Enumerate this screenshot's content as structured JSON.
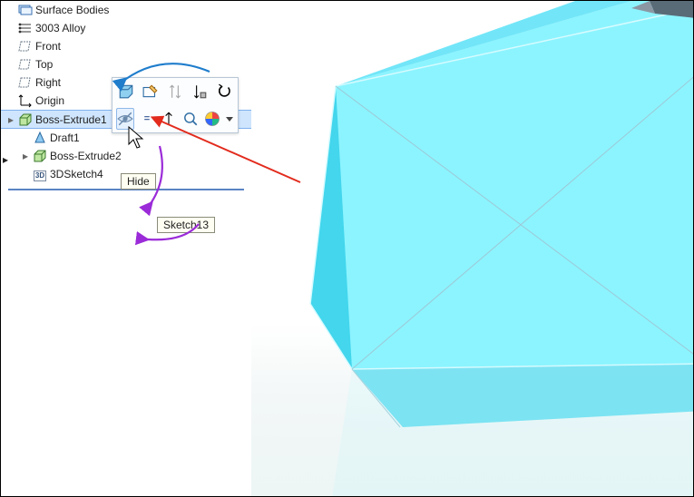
{
  "tree": {
    "items": [
      {
        "id": "surface-bodies",
        "icon": "surfaces",
        "label": "Surface Bodies",
        "selected": false,
        "expandable": false,
        "indent": 0
      },
      {
        "id": "material",
        "icon": "material",
        "label": "3003 Alloy",
        "selected": false,
        "expandable": false,
        "indent": 0
      },
      {
        "id": "front",
        "icon": "plane",
        "label": "Front",
        "selected": false,
        "expandable": false,
        "indent": 0
      },
      {
        "id": "top",
        "icon": "plane",
        "label": "Top",
        "selected": false,
        "expandable": false,
        "indent": 0
      },
      {
        "id": "right",
        "icon": "plane",
        "label": "Right",
        "selected": false,
        "expandable": false,
        "indent": 0
      },
      {
        "id": "origin",
        "icon": "origin",
        "label": "Origin",
        "selected": false,
        "expandable": false,
        "indent": 0
      },
      {
        "id": "boss-extrude1",
        "icon": "extrude",
        "label": "Boss-Extrude1",
        "selected": true,
        "expandable": true,
        "indent": 0
      },
      {
        "id": "draft1",
        "icon": "draft",
        "label": "Draft1",
        "selected": false,
        "expandable": false,
        "indent": 1
      },
      {
        "id": "boss-extrude2",
        "icon": "extrude",
        "label": "Boss-Extrude2",
        "selected": false,
        "expandable": true,
        "indent": 1
      },
      {
        "id": "3dsketch4",
        "icon": "sketch3d",
        "label": "3DSketch4",
        "selected": false,
        "expandable": false,
        "indent": 1
      }
    ]
  },
  "contextToolbar": {
    "row1": [
      "edit-feature",
      "edit-sketch",
      "flip",
      "suppress",
      "undo"
    ],
    "row2": [
      "hide",
      "isolate",
      "normal-to",
      "zoom-to",
      "appearance",
      "dropdown"
    ]
  },
  "tooltip": {
    "text": "Hide"
  },
  "sketchTooltip": {
    "text": "Sketch13"
  },
  "colors": {
    "selection": "#cfe5fd",
    "solid": "#5be9ff",
    "solidDark": "#35cfe8",
    "annoRed": "#e22b1d",
    "annoBlue": "#1f7dcc",
    "annoPurple": "#9b2bd8"
  }
}
